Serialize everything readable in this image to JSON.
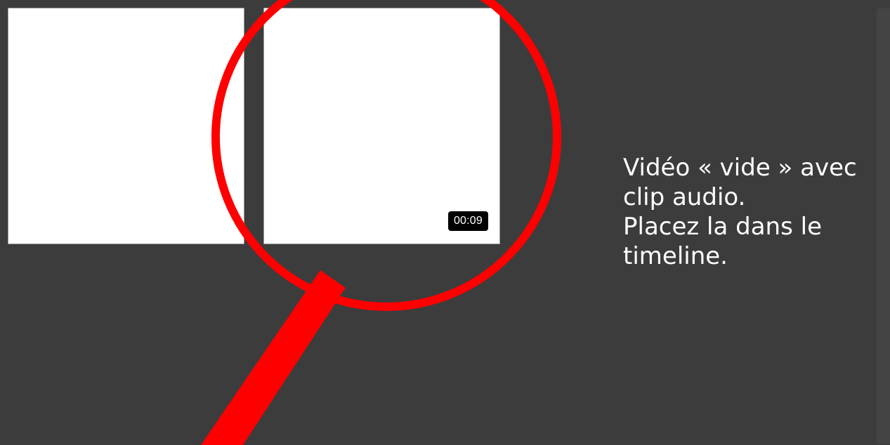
{
  "media_bin": {
    "items": [
      {
        "duration": ""
      },
      {
        "duration": "00:09"
      }
    ]
  },
  "annotation": {
    "lines": [
      "Vidéo « vide » avec",
      "clip audio.",
      "Placez la dans le",
      "timeline."
    ],
    "highlight_color": "#ff0000"
  },
  "icons": {
    "magnifier": "magnifying-glass-icon"
  }
}
